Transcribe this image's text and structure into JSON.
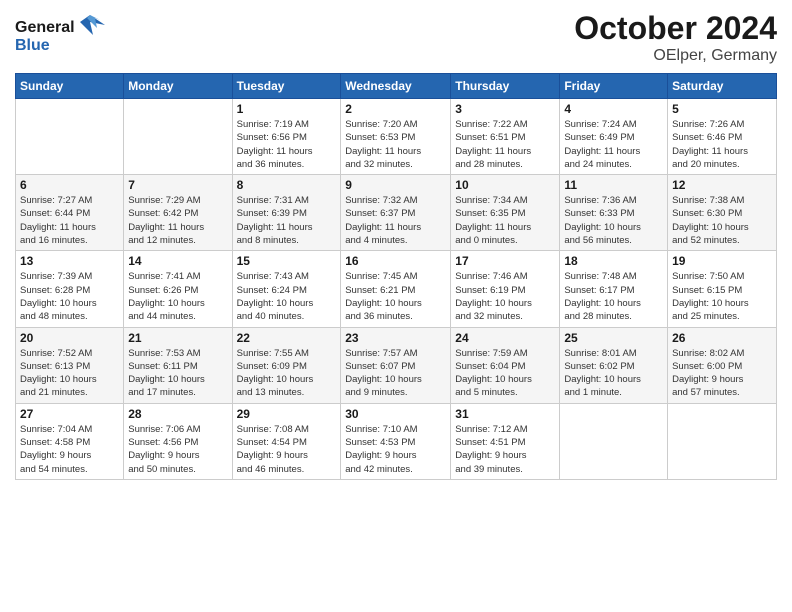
{
  "header": {
    "logo_general": "General",
    "logo_blue": "Blue",
    "month_title": "October 2024",
    "location": "OElper, Germany"
  },
  "days_of_week": [
    "Sunday",
    "Monday",
    "Tuesday",
    "Wednesday",
    "Thursday",
    "Friday",
    "Saturday"
  ],
  "weeks": [
    [
      {
        "day": "",
        "info": ""
      },
      {
        "day": "",
        "info": ""
      },
      {
        "day": "1",
        "info": "Sunrise: 7:19 AM\nSunset: 6:56 PM\nDaylight: 11 hours\nand 36 minutes."
      },
      {
        "day": "2",
        "info": "Sunrise: 7:20 AM\nSunset: 6:53 PM\nDaylight: 11 hours\nand 32 minutes."
      },
      {
        "day": "3",
        "info": "Sunrise: 7:22 AM\nSunset: 6:51 PM\nDaylight: 11 hours\nand 28 minutes."
      },
      {
        "day": "4",
        "info": "Sunrise: 7:24 AM\nSunset: 6:49 PM\nDaylight: 11 hours\nand 24 minutes."
      },
      {
        "day": "5",
        "info": "Sunrise: 7:26 AM\nSunset: 6:46 PM\nDaylight: 11 hours\nand 20 minutes."
      }
    ],
    [
      {
        "day": "6",
        "info": "Sunrise: 7:27 AM\nSunset: 6:44 PM\nDaylight: 11 hours\nand 16 minutes."
      },
      {
        "day": "7",
        "info": "Sunrise: 7:29 AM\nSunset: 6:42 PM\nDaylight: 11 hours\nand 12 minutes."
      },
      {
        "day": "8",
        "info": "Sunrise: 7:31 AM\nSunset: 6:39 PM\nDaylight: 11 hours\nand 8 minutes."
      },
      {
        "day": "9",
        "info": "Sunrise: 7:32 AM\nSunset: 6:37 PM\nDaylight: 11 hours\nand 4 minutes."
      },
      {
        "day": "10",
        "info": "Sunrise: 7:34 AM\nSunset: 6:35 PM\nDaylight: 11 hours\nand 0 minutes."
      },
      {
        "day": "11",
        "info": "Sunrise: 7:36 AM\nSunset: 6:33 PM\nDaylight: 10 hours\nand 56 minutes."
      },
      {
        "day": "12",
        "info": "Sunrise: 7:38 AM\nSunset: 6:30 PM\nDaylight: 10 hours\nand 52 minutes."
      }
    ],
    [
      {
        "day": "13",
        "info": "Sunrise: 7:39 AM\nSunset: 6:28 PM\nDaylight: 10 hours\nand 48 minutes."
      },
      {
        "day": "14",
        "info": "Sunrise: 7:41 AM\nSunset: 6:26 PM\nDaylight: 10 hours\nand 44 minutes."
      },
      {
        "day": "15",
        "info": "Sunrise: 7:43 AM\nSunset: 6:24 PM\nDaylight: 10 hours\nand 40 minutes."
      },
      {
        "day": "16",
        "info": "Sunrise: 7:45 AM\nSunset: 6:21 PM\nDaylight: 10 hours\nand 36 minutes."
      },
      {
        "day": "17",
        "info": "Sunrise: 7:46 AM\nSunset: 6:19 PM\nDaylight: 10 hours\nand 32 minutes."
      },
      {
        "day": "18",
        "info": "Sunrise: 7:48 AM\nSunset: 6:17 PM\nDaylight: 10 hours\nand 28 minutes."
      },
      {
        "day": "19",
        "info": "Sunrise: 7:50 AM\nSunset: 6:15 PM\nDaylight: 10 hours\nand 25 minutes."
      }
    ],
    [
      {
        "day": "20",
        "info": "Sunrise: 7:52 AM\nSunset: 6:13 PM\nDaylight: 10 hours\nand 21 minutes."
      },
      {
        "day": "21",
        "info": "Sunrise: 7:53 AM\nSunset: 6:11 PM\nDaylight: 10 hours\nand 17 minutes."
      },
      {
        "day": "22",
        "info": "Sunrise: 7:55 AM\nSunset: 6:09 PM\nDaylight: 10 hours\nand 13 minutes."
      },
      {
        "day": "23",
        "info": "Sunrise: 7:57 AM\nSunset: 6:07 PM\nDaylight: 10 hours\nand 9 minutes."
      },
      {
        "day": "24",
        "info": "Sunrise: 7:59 AM\nSunset: 6:04 PM\nDaylight: 10 hours\nand 5 minutes."
      },
      {
        "day": "25",
        "info": "Sunrise: 8:01 AM\nSunset: 6:02 PM\nDaylight: 10 hours\nand 1 minute."
      },
      {
        "day": "26",
        "info": "Sunrise: 8:02 AM\nSunset: 6:00 PM\nDaylight: 9 hours\nand 57 minutes."
      }
    ],
    [
      {
        "day": "27",
        "info": "Sunrise: 7:04 AM\nSunset: 4:58 PM\nDaylight: 9 hours\nand 54 minutes."
      },
      {
        "day": "28",
        "info": "Sunrise: 7:06 AM\nSunset: 4:56 PM\nDaylight: 9 hours\nand 50 minutes."
      },
      {
        "day": "29",
        "info": "Sunrise: 7:08 AM\nSunset: 4:54 PM\nDaylight: 9 hours\nand 46 minutes."
      },
      {
        "day": "30",
        "info": "Sunrise: 7:10 AM\nSunset: 4:53 PM\nDaylight: 9 hours\nand 42 minutes."
      },
      {
        "day": "31",
        "info": "Sunrise: 7:12 AM\nSunset: 4:51 PM\nDaylight: 9 hours\nand 39 minutes."
      },
      {
        "day": "",
        "info": ""
      },
      {
        "day": "",
        "info": ""
      }
    ]
  ]
}
